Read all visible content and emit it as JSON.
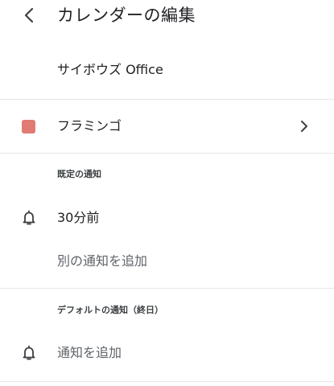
{
  "header": {
    "title": "カレンダーの編集",
    "back_icon": "chevron-left-icon"
  },
  "calendar": {
    "account_name": "サイボウズ Office"
  },
  "color": {
    "label": "フラミンゴ",
    "swatch": "#e07b73",
    "chevron_icon": "chevron-right-icon"
  },
  "default_notifications": {
    "section_label": "既定の通知",
    "items": [
      {
        "label": "30分前",
        "icon": "bell-icon"
      }
    ],
    "add_label": "別の通知を追加"
  },
  "all_day_notifications": {
    "section_label": "デフォルトの通知（終日）",
    "add_label": "通知を追加",
    "icon": "bell-icon"
  }
}
